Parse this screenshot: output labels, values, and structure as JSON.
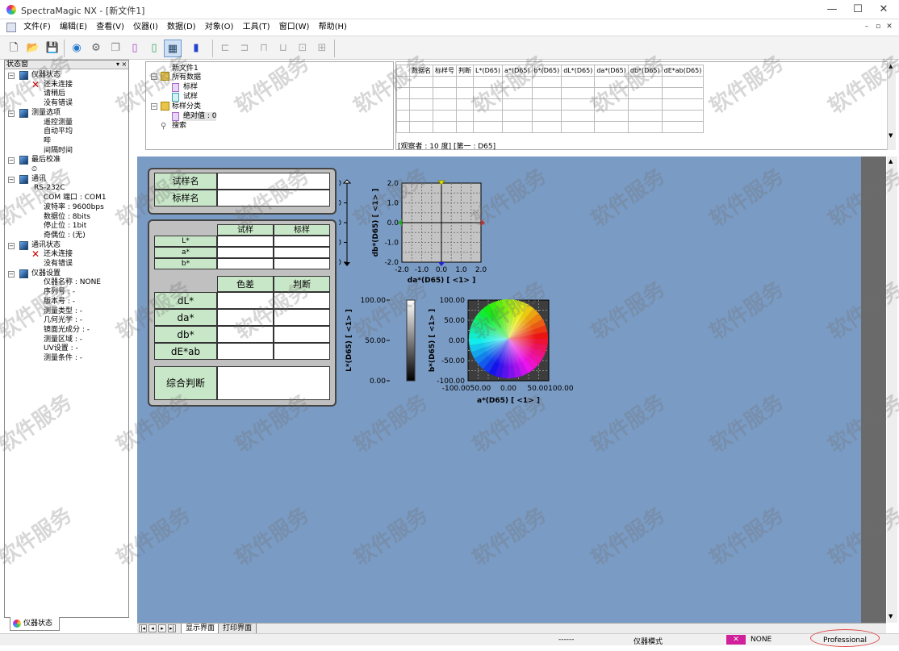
{
  "window": {
    "title": "SpectraMagic NX - [新文件1]",
    "min": "—",
    "max": "☐",
    "close": "✕"
  },
  "menu": [
    "文件(F)",
    "编辑(E)",
    "查看(V)",
    "仪器(I)",
    "数据(D)",
    "对象(O)",
    "工具(T)",
    "窗口(W)",
    "帮助(H)"
  ],
  "mdi_controls": [
    "–",
    "▫",
    "✕"
  ],
  "left_panel": {
    "title": "状态窗",
    "pin": "▾ ×",
    "tab": "仪器状态",
    "rows": [
      {
        "text": "仪器状态",
        "level": 0,
        "icon": "instrument-icon"
      },
      {
        "text": "还未连接",
        "level": 1,
        "icon": "x-mark"
      },
      {
        "text": "请稍后",
        "level": 2
      },
      {
        "text": "没有错误",
        "level": 2
      },
      {
        "text": "测量选项",
        "level": 0,
        "icon": "options-icon"
      },
      {
        "text": "遥控测量",
        "level": 2
      },
      {
        "text": "自动平均",
        "level": 2
      },
      {
        "text": "哔",
        "level": 2
      },
      {
        "text": "间隔时间",
        "level": 2
      },
      {
        "text": "最后校准",
        "level": 0,
        "icon": "calibration-icon"
      },
      {
        "text": "",
        "level": 1,
        "icon": "clock-icon"
      },
      {
        "text": "通讯",
        "level": 0,
        "icon": "comm-icon"
      },
      {
        "text": "RS-232C",
        "level": 1
      },
      {
        "text": "COM 端口 : COM1",
        "level": 2
      },
      {
        "text": "波特率 : 9600bps",
        "level": 2
      },
      {
        "text": "数据位 : 8bits",
        "level": 2
      },
      {
        "text": "停止位 : 1bit",
        "level": 2
      },
      {
        "text": "奇偶位 : (无)",
        "level": 2
      },
      {
        "text": "通讯状态",
        "level": 0,
        "icon": "comm-status-icon"
      },
      {
        "text": "还未连接",
        "level": 1,
        "icon": "x-mark"
      },
      {
        "text": "没有错误",
        "level": 2
      },
      {
        "text": "仪器设置",
        "level": 0,
        "icon": "settings-icon"
      },
      {
        "text": "仪器名称 : NONE",
        "level": 2
      },
      {
        "text": "序列号 : -",
        "level": 2
      },
      {
        "text": "版本号 : -",
        "level": 2
      },
      {
        "text": "测量类型 : -",
        "level": 2
      },
      {
        "text": "几何光学 : -",
        "level": 2
      },
      {
        "text": "镜面光成分 : -",
        "level": 2
      },
      {
        "text": "测量区域 : -",
        "level": 2
      },
      {
        "text": "UV设置 : -",
        "level": 2
      },
      {
        "text": "测量条件 : -",
        "level": 2
      }
    ]
  },
  "data_tree": {
    "root": "新文件1",
    "all_data": "所有数据",
    "standard": "标样",
    "sample": "试样",
    "category": "标样分类",
    "absolute": "绝对值 : 0",
    "search": "搜索"
  },
  "grid": {
    "headers": [
      "数据名",
      "标样号",
      "判断",
      "L*(D65)",
      "a*(D65)",
      "b*(D65)",
      "dL*(D65)",
      "da*(D65)",
      "db*(D65)",
      "dE*ab(D65)"
    ],
    "status": "[观察者 : 10 度] [第一 : D65]"
  },
  "form": {
    "sample_name": "试样名",
    "standard_name": "标样名",
    "col_sample": "试样",
    "col_standard": "标样",
    "L": "L*",
    "a": "a*",
    "b": "b*",
    "col_diff": "色差",
    "col_judge": "判断",
    "dL": "dL*",
    "da": "da*",
    "db": "db*",
    "dE": "dE*ab",
    "overall": "综合判断"
  },
  "chart_data": [
    {
      "type": "scatter",
      "xlabel": "",
      "ylabel": "dL*(D65) [ <1> ]",
      "ylim": [
        -2.0,
        2.0
      ],
      "yticks": [
        "2.0",
        "1.0",
        "0.0",
        "-1.0",
        "-2.0"
      ]
    },
    {
      "type": "scatter",
      "xlabel": "da*(D65) [ <1> ]",
      "ylabel": "db*(D65) [ <1> ]",
      "xlim": [
        -2.0,
        2.0
      ],
      "ylim": [
        -2.0,
        2.0
      ],
      "xticks": [
        "-2.0",
        "-1.0",
        "0.0",
        "1.0",
        "2.0"
      ],
      "yticks": [
        "2.0",
        "1.0",
        "0.0",
        "-1.0",
        "-2.0"
      ],
      "grid": true
    },
    {
      "type": "scatter",
      "xlabel": "",
      "ylabel": "L*(D65) [ <1> ]",
      "ylim": [
        0,
        100
      ],
      "yticks": [
        "100.00",
        "50.00",
        "0.00"
      ]
    },
    {
      "type": "scatter",
      "xlabel": "a*(D65) [ <1> ]",
      "ylabel": "b*(D65) [ <1> ]",
      "xlim": [
        -100,
        100
      ],
      "ylim": [
        -100,
        100
      ],
      "xticks": [
        "-100.0050.00",
        "0.00",
        "50.00100.00"
      ],
      "yticks": [
        "100.00",
        "50.00",
        "0.00",
        "-50.00",
        "-100.00"
      ],
      "grid": true
    }
  ],
  "bottom_tabs": [
    "显示界面",
    "打印界面"
  ],
  "status_bar": {
    "dashes": "------",
    "mode": "仪器模式",
    "device": "NONE",
    "edition": "Professional"
  },
  "watermark": "软件服务"
}
